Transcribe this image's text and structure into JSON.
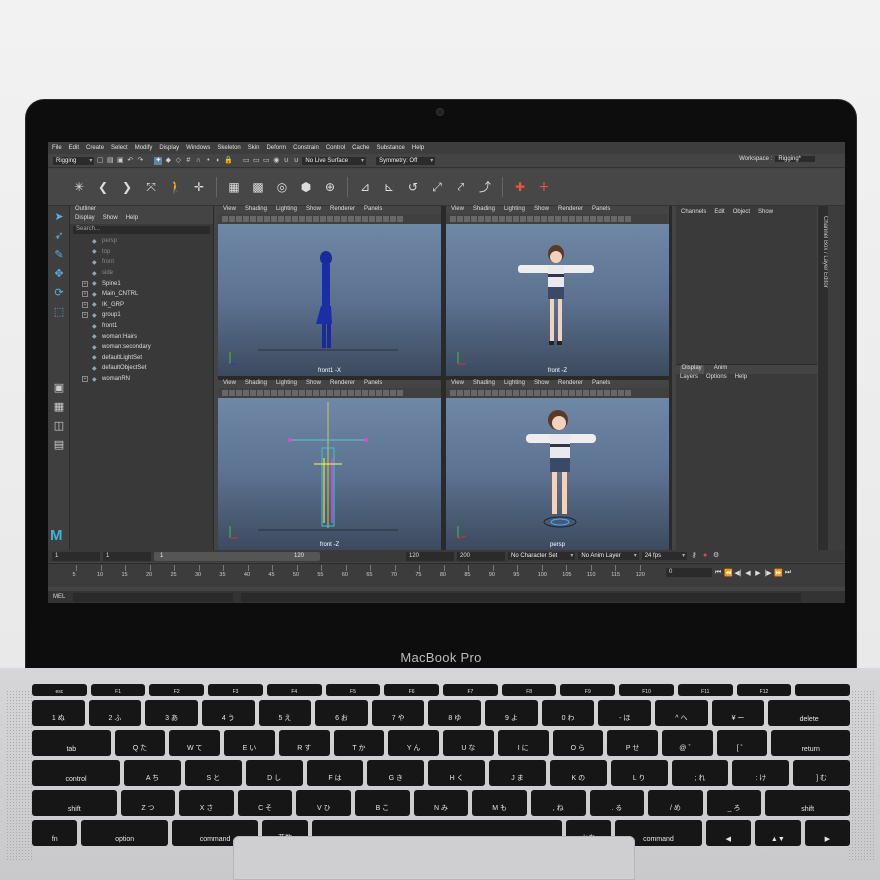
{
  "device": {
    "brand_label": "MacBook Pro"
  },
  "menubar": {
    "items": [
      "File",
      "Edit",
      "Create",
      "Select",
      "Modify",
      "Display",
      "Windows",
      "Skeleton",
      "Skin",
      "Deform",
      "Constrain",
      "Control",
      "Cache",
      "Substance",
      "Help"
    ],
    "workspace_label": "Workspace :",
    "workspace_value": "Rigging*"
  },
  "status_line": {
    "menu_set": "Rigging",
    "live_surface": "No Live Surface",
    "symmetry": "Symmetry: Off"
  },
  "outliner": {
    "title": "Outliner",
    "menu": [
      "Display",
      "Show",
      "Help"
    ],
    "search_placeholder": "Search...",
    "items": [
      {
        "label": "persp",
        "dim": true,
        "expand": false,
        "icon": "camera-icon"
      },
      {
        "label": "top",
        "dim": true,
        "expand": false,
        "icon": "camera-icon"
      },
      {
        "label": "front",
        "dim": true,
        "expand": false,
        "icon": "camera-icon"
      },
      {
        "label": "side",
        "dim": true,
        "expand": false,
        "icon": "camera-icon"
      },
      {
        "label": "Spine1",
        "dim": false,
        "expand": true,
        "icon": "joint-icon"
      },
      {
        "label": "Main_CNTRL",
        "dim": false,
        "expand": true,
        "icon": "curve-icon"
      },
      {
        "label": "IK_GRP",
        "dim": false,
        "expand": true,
        "icon": "group-icon"
      },
      {
        "label": "group1",
        "dim": false,
        "expand": true,
        "icon": "group-icon"
      },
      {
        "label": "front1",
        "dim": false,
        "expand": false,
        "icon": "camera-icon"
      },
      {
        "label": "woman:Hairs",
        "dim": false,
        "expand": false,
        "icon": "set-icon"
      },
      {
        "label": "woman:secondary",
        "dim": false,
        "expand": false,
        "icon": "set-icon"
      },
      {
        "label": "defaultLightSet",
        "dim": false,
        "expand": false,
        "icon": "set-icon"
      },
      {
        "label": "defaultObjectSet",
        "dim": false,
        "expand": false,
        "icon": "set-icon"
      },
      {
        "label": "womanRN",
        "dim": false,
        "expand": true,
        "icon": "reference-icon"
      }
    ]
  },
  "viewport_menu": [
    "View",
    "Shading",
    "Lighting",
    "Show",
    "Renderer",
    "Panels"
  ],
  "viewports": [
    {
      "camera": "front1 -X"
    },
    {
      "camera": "front -Z"
    },
    {
      "camera": "front -Z"
    },
    {
      "camera": "persp"
    }
  ],
  "channel_box": {
    "menu": [
      "Channels",
      "Edit",
      "Object",
      "Show"
    ],
    "side_tab": "Channel Box / Layer Editor"
  },
  "layer_editor": {
    "tabs": [
      "Display",
      "Anim"
    ],
    "menu": [
      "Layers",
      "Options",
      "Help"
    ]
  },
  "range_slider": {
    "start": "1",
    "playback_start": "1",
    "slider_start": "1",
    "slider_end": "120",
    "playback_end": "120",
    "end": "200",
    "character_set": "No Character Set",
    "anim_layer": "No Anim Layer",
    "fps": "24 fps"
  },
  "time_slider": {
    "ticks": [
      "5",
      "10",
      "15",
      "20",
      "25",
      "30",
      "35",
      "40",
      "45",
      "50",
      "55",
      "60",
      "65",
      "70",
      "75",
      "80",
      "85",
      "90",
      "95",
      "100",
      "105",
      "110",
      "115",
      "120"
    ],
    "current_frame": "0"
  },
  "command_line": {
    "label": "MEL"
  },
  "keyboard": {
    "fn_row": [
      "esc",
      "F1",
      "F2",
      "F3",
      "F4",
      "F5",
      "F6",
      "F7",
      "F8",
      "F9",
      "F10",
      "F11",
      "F12",
      ""
    ],
    "row1": [
      "1 ぬ",
      "2 ふ",
      "3 あ",
      "4 う",
      "5 え",
      "6 お",
      "7 や",
      "8 ゆ",
      "9 よ",
      "0 わ",
      "- ほ",
      "^ へ",
      "¥ ー",
      "delete"
    ],
    "row2": [
      "tab",
      "Q た",
      "W て",
      "E い",
      "R す",
      "T か",
      "Y ん",
      "U な",
      "I に",
      "O ら",
      "P せ",
      "@ ゛",
      "[ ゜",
      "return"
    ],
    "row3": [
      "control",
      "A ち",
      "S と",
      "D し",
      "F は",
      "G き",
      "H く",
      "J ま",
      "K の",
      "L り",
      "; れ",
      ": け",
      "] む"
    ],
    "row4": [
      "shift",
      "Z つ",
      "X さ",
      "C そ",
      "V ひ",
      "B こ",
      "N み",
      "M も",
      ", ね",
      ". る",
      "/ め",
      "_ ろ",
      "shift"
    ],
    "row5": [
      "fn",
      "option",
      "command",
      "英数",
      "",
      "かな",
      "command",
      "◀",
      "▲▼",
      "▶"
    ]
  }
}
